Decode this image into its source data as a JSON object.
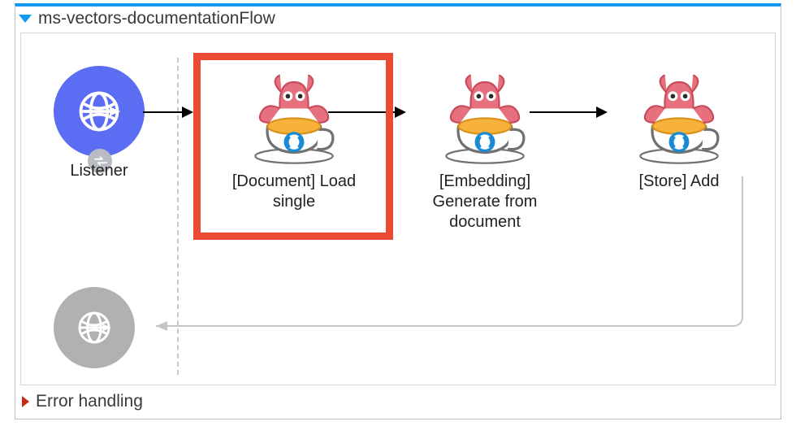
{
  "flow": {
    "title": "ms-vectors-documentationFlow",
    "listener_label": "Listener",
    "nodes": [
      {
        "label": "[Document] Load single"
      },
      {
        "label": "[Embedding] Generate from document"
      },
      {
        "label": "[Store] Add"
      }
    ],
    "selected_node_index": 0,
    "error_section_label": "Error handling"
  },
  "icons": {
    "listener": "globe-arrow-icon",
    "exchange": "exchange-icon",
    "connector": "mule-octopus-cup-icon",
    "response": "globe-arrow-icon"
  },
  "colors": {
    "accent_border": "#1399f1",
    "listener_bg": "#5b6df2",
    "selection": "#ea4b33",
    "error_triangle": "#cc2a18"
  }
}
